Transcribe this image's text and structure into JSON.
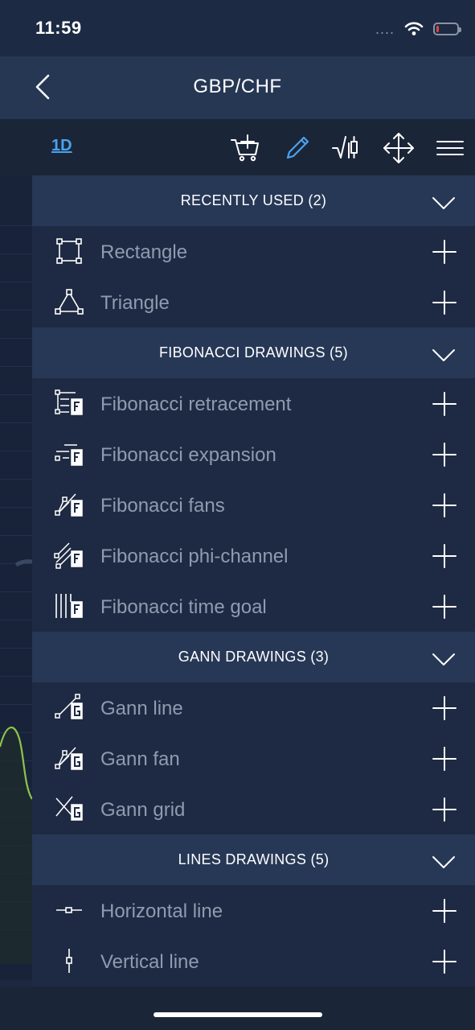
{
  "status": {
    "time": "11:59",
    "signal": "....",
    "battery_level": 0.12
  },
  "nav": {
    "title": "GBP/CHF"
  },
  "toolbar": {
    "period": "1D",
    "icons": [
      "cart-add-icon",
      "pencil-icon",
      "indicator-chart-icon",
      "move-arrows-icon",
      "menu-icon"
    ],
    "active_color": "#4aa3ee"
  },
  "sections": [
    {
      "title": "RECENTLY USED (2)",
      "items": [
        {
          "label": "Rectangle",
          "icon": "rectangle-icon"
        },
        {
          "label": "Triangle",
          "icon": "triangle-icon"
        }
      ]
    },
    {
      "title": "FIBONACCI DRAWINGS (5)",
      "items": [
        {
          "label": "Fibonacci retracement",
          "icon": "fibonacci-retracement-icon"
        },
        {
          "label": "Fibonacci expansion",
          "icon": "fibonacci-expansion-icon"
        },
        {
          "label": "Fibonacci fans",
          "icon": "fibonacci-fans-icon"
        },
        {
          "label": "Fibonacci phi-channel",
          "icon": "fibonacci-phi-channel-icon"
        },
        {
          "label": "Fibonacci time goal",
          "icon": "fibonacci-time-goal-icon"
        }
      ]
    },
    {
      "title": "GANN DRAWINGS (3)",
      "items": [
        {
          "label": "Gann line",
          "icon": "gann-line-icon"
        },
        {
          "label": "Gann fan",
          "icon": "gann-fan-icon"
        },
        {
          "label": "Gann grid",
          "icon": "gann-grid-icon"
        }
      ]
    },
    {
      "title": "LINES DRAWINGS (5)",
      "items": [
        {
          "label": "Horizontal line",
          "icon": "horizontal-line-icon"
        },
        {
          "label": "Vertical line",
          "icon": "vertical-line-icon"
        }
      ]
    }
  ]
}
